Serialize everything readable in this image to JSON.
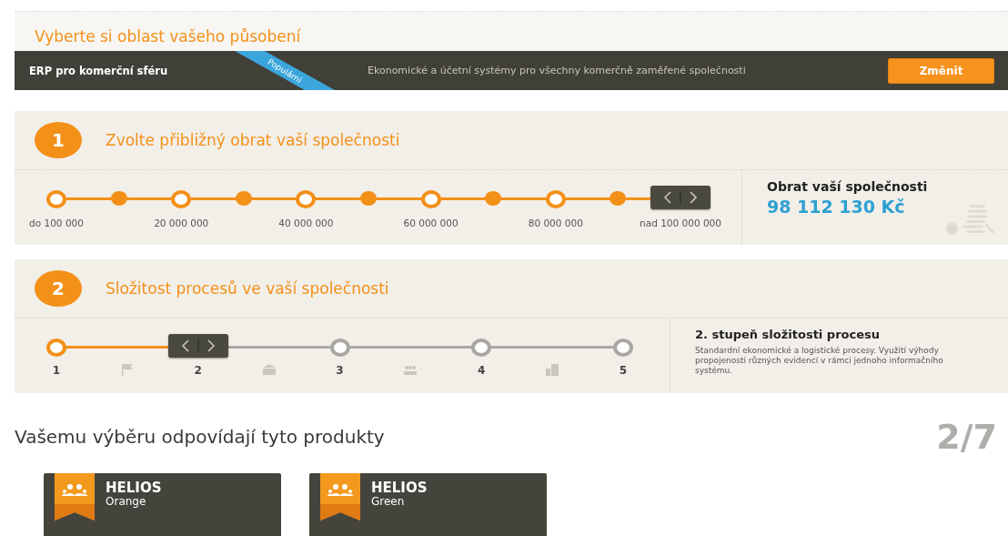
{
  "header": {
    "title": "Vyberte si oblast vašeho působení"
  },
  "area_bar": {
    "name": "ERP pro komerční sféru",
    "ribbon": "Populární",
    "description": "Ekonomické a účetní systémy pro všechny komerčně zaměřené společnosti",
    "button": "Změnit"
  },
  "steps": [
    {
      "number": "1",
      "title": "Zvolte přibližný obrat vaší společnosti",
      "kind": "turnover",
      "slider": {
        "level": 1,
        "labels": [
          "do 100 000",
          "20 000 000",
          "40 000 000",
          "60 000 000",
          "80 000 000",
          "nad 100 000 000"
        ]
      },
      "info": {
        "title": "Obrat vaší společnosti",
        "value": "98 112 130 Kč"
      }
    },
    {
      "number": "2",
      "title": "Složitost procesů ve vaší společnosti",
      "kind": "complexity",
      "slider": {
        "level": 0.25,
        "labels": [
          "1",
          "2",
          "3",
          "4",
          "5"
        ]
      },
      "info": {
        "title": "2. stupeň složitosti procesu",
        "text": "Standardní ekonomické a logistické procesy. Využití výhody propojenosti různých evidencí v rámci jednoho informačního systému."
      }
    }
  ],
  "results": {
    "title": "Vašemu výběru odpovídají tyto produkty",
    "counter": "2/7",
    "products": [
      {
        "brand": "HELIOS",
        "name": "Orange"
      },
      {
        "brand": "HELIOS",
        "name": "Green"
      }
    ]
  }
}
